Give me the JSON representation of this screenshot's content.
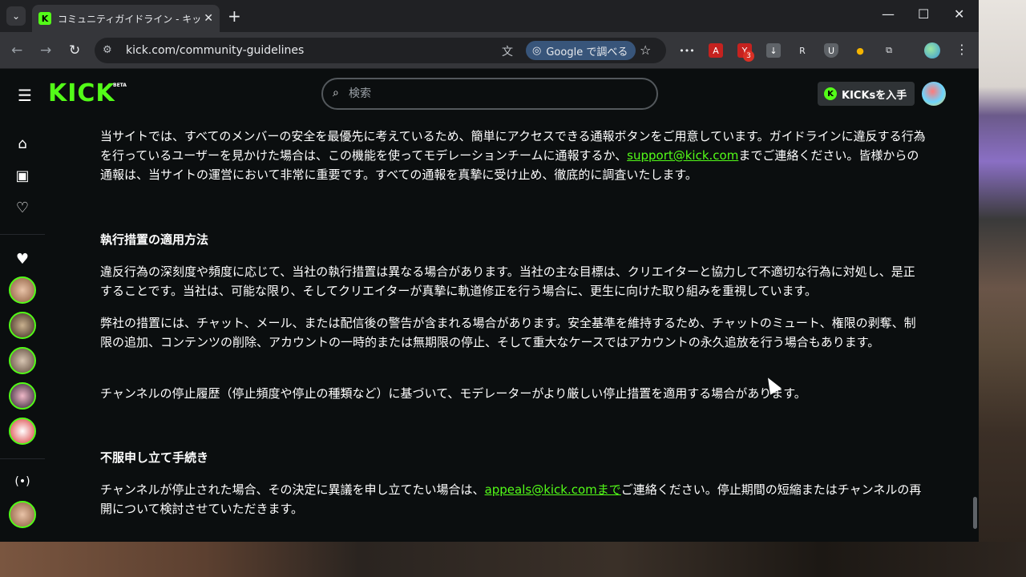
{
  "browser": {
    "tab_title": "コミュニティガイドライン - キックストリーミング",
    "url": "kick.com/community-guidelines",
    "google_lens_label": "Google で調べる",
    "ext_badge_count": "3"
  },
  "header": {
    "logo": "KICK",
    "beta": "BETA",
    "search_placeholder": "検索",
    "kicks_button_label": "KICKsを入手",
    "kicks_icon_letter": "K"
  },
  "content": {
    "para_report_1": "当サイトでは、すべてのメンバーの安全を最優先に考えているため、簡単にアクセスできる通報ボタンをご用意しています。ガイドラインに違反する行為を行っているユーザーを見かけた場合は、この機能を使ってモデレーションチームに通報するか、",
    "report_email": "support@kick.com",
    "para_report_2": "までご連絡ください。皆様からの通報は、当サイトの運営において非常に重要です。すべての通報を真摯に受け止め、徹底的に調査いたします。",
    "heading_enforcement": "執行措置の適用方法",
    "para_enforcement_1": "違反行為の深刻度や頻度に応じて、当社の執行措置は異なる場合があります。当社の主な目標は、クリエイターと協力して不適切な行為に対処し、是正することです。当社は、可能な限り、そしてクリエイターが真摯に軌道修正を行う場合に、更生に向けた取り組みを重視しています。",
    "para_enforcement_2": "弊社の措置には、チャット、メール、または配信後の警告が含まれる場合があります。安全基準を維持するため、チャットのミュート、権限の剥奪、制限の追加、コンテンツの削除、アカウントの一時的または無期限の停止、そして重大なケースではアカウントの永久追放を行う場合もあります。",
    "para_enforcement_3": "チャンネルの停止履歴（停止頻度や停止の種類など）に基づいて、モデレーターがより厳しい停止措置を適用する場合があります。",
    "heading_appeal": "不服申し立て手続き",
    "para_appeal_1": "チャンネルが停止された場合、その決定に異議を申し立てたい場合は、",
    "appeal_email": "appeals@kick.comまで",
    "para_appeal_2": "ご連絡ください。停止期間の短縮またはチャンネルの再開について検討させていただきます。"
  }
}
